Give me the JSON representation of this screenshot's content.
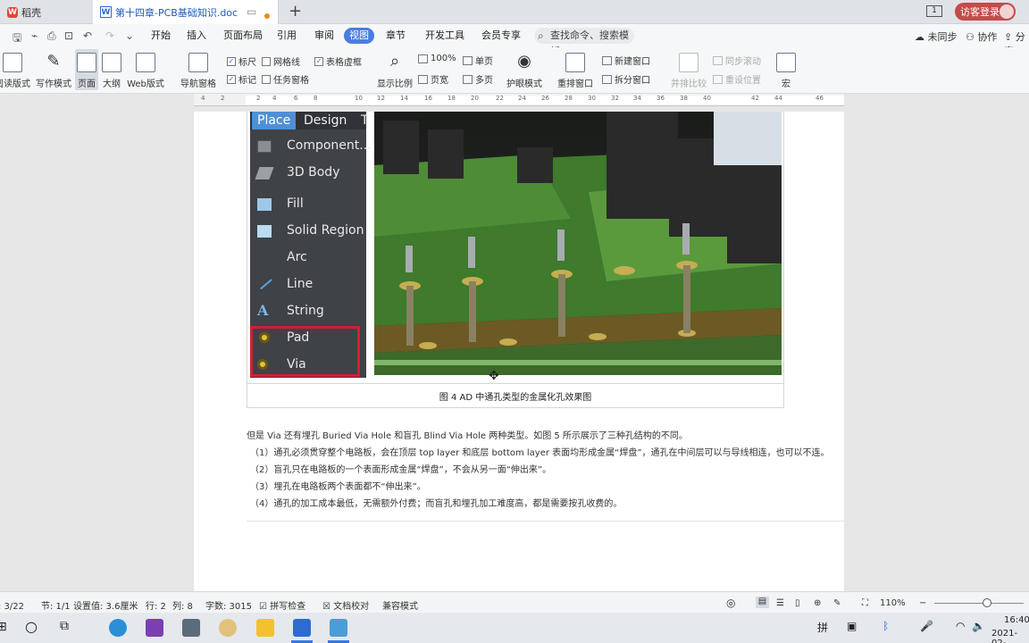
{
  "tabs": {
    "home_label": "稻壳",
    "doc_label": "第十四章-PCB基础知识.doc"
  },
  "header": {
    "badge": "1",
    "login_label": "访客登录"
  },
  "menu": {
    "items": [
      "开始",
      "插入",
      "页面布局",
      "引用",
      "审阅",
      "视图",
      "章节",
      "开发工具",
      "会员专享"
    ],
    "active": "视图",
    "search_placeholder": "查找命令、搜索模板",
    "sync": "未同步",
    "collab": "协作",
    "share": "分享"
  },
  "ribbon": {
    "read_mode": "阅读版式",
    "write_mode": "写作模式",
    "page_mode": "页面",
    "outline": "大纲",
    "web_mode": "Web版式",
    "nav_pane": "导航窗格",
    "ruler": "标尺",
    "gridlines": "网格线",
    "table_borders": "表格虚框",
    "marks": "标记",
    "task_pane": "任务窗格",
    "zoom_display": "显示比例",
    "zoom_100": "100%",
    "single_page": "单页",
    "page_width": "页宽",
    "multi_page": "多页",
    "eye_protect": "护眼模式",
    "arrange": "重排窗口",
    "new_window": "新建窗口",
    "split_window": "拆分窗口",
    "side_by_side": "并排比较",
    "sync_scroll": "同步滚动",
    "reset_pos": "重设位置",
    "macro": "宏"
  },
  "ruler_ticks": [
    "4",
    "2",
    "2",
    "4",
    "6",
    "8",
    "10",
    "12",
    "14",
    "16",
    "18",
    "20",
    "22",
    "24",
    "26",
    "28",
    "30",
    "32",
    "34",
    "36",
    "38",
    "40",
    "42",
    "44",
    "46"
  ],
  "altium_menu": {
    "tab_place": "Place",
    "tab_design": "Design",
    "tab_more": "T",
    "items": [
      "Component...",
      "3D Body",
      "Fill",
      "Solid Region",
      "Arc",
      "Line",
      "String",
      "Pad",
      "Via"
    ]
  },
  "document": {
    "caption": "图 4 AD 中通孔类型的金属化孔效果图",
    "intro": "但是 Via 还有埋孔 Buried Via Hole 和盲孔 Blind Via Hole 两种类型。如图 5 所示展示了三种孔结构的不同。",
    "points": [
      "（1）通孔必须贯穿整个电路板，会在顶层 top layer 和底层 bottom layer 表面均形成金属“焊盘”，通孔在中间层可以与导线相连，也可以不连。",
      "（2）盲孔只在电路板的一个表面形成金属“焊盘”，不会从另一面“伸出来”。",
      "（3）埋孔在电路板两个表面都不“伸出来”。",
      "（4）通孔的加工成本最低，无需额外付费；而盲孔和埋孔加工难度高，都是需要按孔收费的。"
    ]
  },
  "status": {
    "page": "页: 3/22",
    "section": "节: 1/1",
    "setting": "设置值: 3.6厘米",
    "row": "行: 2",
    "col": "列: 8",
    "words": "字数: 3015",
    "spell": "拼写检查",
    "proof": "文档校对",
    "compat": "兼容模式",
    "zoom": "110%"
  },
  "taskbar": {
    "time": "16:40",
    "date": "2021-02-"
  }
}
